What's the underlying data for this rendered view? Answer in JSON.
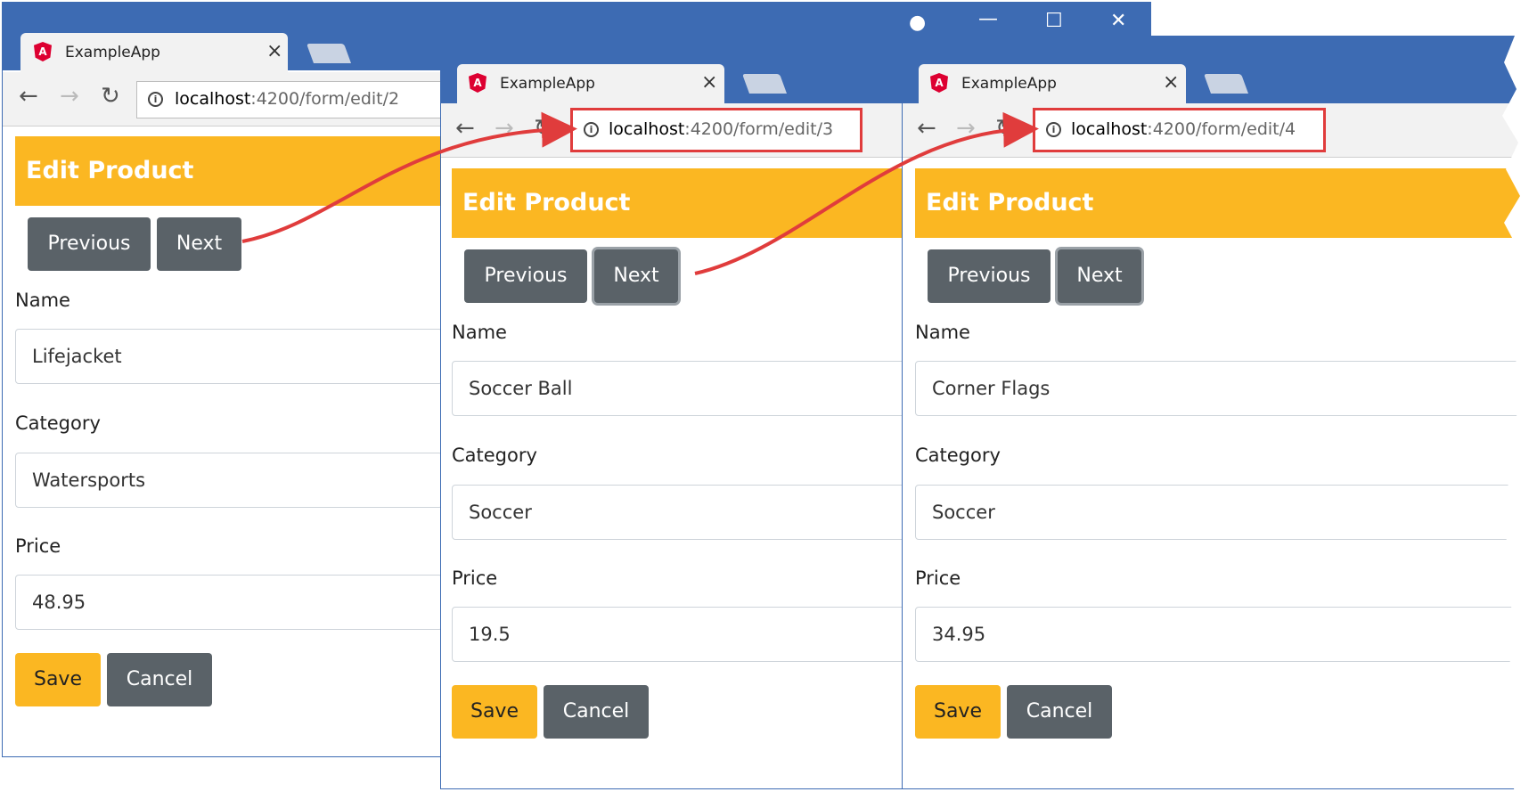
{
  "windows": [
    {
      "tab_title": "ExampleApp",
      "url_host": "localhost",
      "url_path": ":4200/form/edit/2",
      "header": "Edit Product",
      "prev_label": "Previous",
      "next_label": "Next",
      "name_label": "Name",
      "name_value": "Lifejacket",
      "category_label": "Category",
      "category_value": "Watersports",
      "price_label": "Price",
      "price_value": "48.95",
      "save_label": "Save",
      "cancel_label": "Cancel"
    },
    {
      "tab_title": "ExampleApp",
      "url_host": "localhost",
      "url_path": ":4200/form/edit/3",
      "header": "Edit Product",
      "prev_label": "Previous",
      "next_label": "Next",
      "name_label": "Name",
      "name_value": "Soccer Ball",
      "category_label": "Category",
      "category_value": "Soccer",
      "price_label": "Price",
      "price_value": "19.5",
      "save_label": "Save",
      "cancel_label": "Cancel"
    },
    {
      "tab_title": "ExampleApp",
      "url_host": "localhost",
      "url_path": ":4200/form/edit/4",
      "header": "Edit Product",
      "prev_label": "Previous",
      "next_label": "Next",
      "name_label": "Name",
      "name_value": "Corner Flags",
      "category_label": "Category",
      "category_value": "Soccer",
      "price_label": "Price",
      "price_value": "34.95",
      "save_label": "Save",
      "cancel_label": "Cancel"
    }
  ],
  "colors": {
    "titlebar": "#3d6bb3",
    "header": "#fbb722",
    "dark_button": "#5a6268",
    "highlight": "#e03c3c"
  },
  "icons": [
    "angular-logo-icon",
    "close-icon",
    "back-icon",
    "forward-icon",
    "reload-icon",
    "info-icon",
    "user-icon",
    "minimize-icon",
    "maximize-icon",
    "window-close-icon"
  ]
}
